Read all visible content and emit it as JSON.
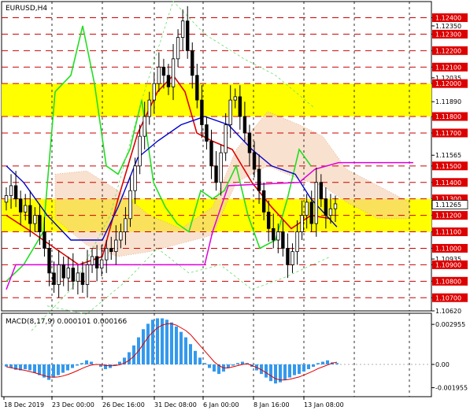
{
  "chart_data": {
    "type": "candlestick",
    "symbol_timeframe": "EURUSD,H4",
    "price_axis": {
      "range": [
        1.1062,
        1.1245
      ],
      "ticks": [
        "1.12400",
        "1.12350",
        "1.12300",
        "1.12200",
        "1.12100",
        "1.12035",
        "1.12000",
        "1.11890",
        "1.11800",
        "1.11700",
        "1.11565",
        "1.11500",
        "1.11400",
        "1.11300",
        "1.11265",
        "1.11200",
        "1.11100",
        "1.11000",
        "1.10935",
        "1.10900",
        "1.10800",
        "1.10700",
        "1.10620"
      ],
      "highlighted_levels": [
        "1.12400",
        "1.12300",
        "1.12200",
        "1.12100",
        "1.12000",
        "1.11800",
        "1.11700",
        "1.11500",
        "1.11400",
        "1.11300",
        "1.11200",
        "1.11100",
        "1.11000",
        "1.10900",
        "1.10800",
        "1.10700"
      ],
      "current_price": "1.11265"
    },
    "time_axis": [
      "18 Dec 2019",
      "23 Dec 00:00",
      "26 Dec 16:00",
      "31 Dec 08:00",
      "6 Jan 00:00",
      "8 Jan 16:00",
      "13 Jan 08:00"
    ],
    "resistance_support_zones": [
      {
        "from": 1.118,
        "to": 1.12
      },
      {
        "from": 1.111,
        "to": 1.113
      }
    ],
    "macd": {
      "label": "MACD(8,17,9) 0.000101 0.000166",
      "ticks": [
        "0.002955",
        "0.00",
        "-0.001955"
      ],
      "range": [
        -0.0023,
        0.0033
      ],
      "histogram": [
        -0.00018,
        -0.0003,
        -0.00045,
        -0.0005,
        -0.0004,
        -0.0005,
        -0.0007,
        -0.0009,
        -0.0011,
        -0.0013,
        -0.0011,
        -0.0009,
        -0.0007,
        -0.0005,
        -0.0003,
        -0.0001,
        0.0001,
        0.0003,
        0.0002,
        0.0,
        -0.0002,
        -0.0004,
        -0.0003,
        -0.0001,
        0.0002,
        0.0005,
        0.0009,
        0.0014,
        0.002,
        0.0026,
        0.003,
        0.0033,
        0.0034,
        0.0034,
        0.0033,
        0.0031,
        0.0028,
        0.0024,
        0.002,
        0.0015,
        0.001,
        0.0005,
        0.0001,
        -0.0003,
        -0.0006,
        -0.0008,
        -0.0006,
        -0.0003,
        -0.0001,
        0.0001,
        0.0002,
        0.0001,
        -0.0002,
        -0.0005,
        -0.0008,
        -0.0011,
        -0.0014,
        -0.0016,
        -0.0015,
        -0.0013,
        -0.0011,
        -0.0009,
        -0.0008,
        -0.0006,
        -0.0004,
        -0.0002,
        0.0001,
        0.0002,
        0.0003,
        0.00015,
        0.0001
      ],
      "signal": [
        -0.0002,
        -0.00028,
        -0.00036,
        -0.00043,
        -0.0005,
        -0.0006,
        -0.0007,
        -0.00082,
        -0.00094,
        -0.00105,
        -0.00108,
        -0.00105,
        -0.00097,
        -0.00085,
        -0.0007,
        -0.00053,
        -0.00035,
        -0.00018,
        -6e-05,
        0.0,
        -2e-05,
        -9e-05,
        -0.00012,
        -0.0001,
        -3e-05,
        0.0001,
        0.0003,
        0.0006,
        0.001,
        0.0015,
        0.002,
        0.0024,
        0.0027,
        0.0029,
        0.003,
        0.003,
        0.0029,
        0.0027,
        0.0025,
        0.0022,
        0.0018,
        0.0014,
        0.001,
        0.0006,
        0.0002,
        -0.0001,
        -0.0003,
        -0.0003,
        -0.0002,
        -0.0001,
        0.0,
        5e-05,
        -0.0001,
        -0.00025,
        -0.00045,
        -0.0007,
        -0.00095,
        -0.0012,
        -0.0013,
        -0.0013,
        -0.00125,
        -0.00115,
        -0.00105,
        -0.0009,
        -0.00072,
        -0.00055,
        -0.00035,
        -0.0002,
        -5e-05,
        0.0001,
        0.000166
      ]
    }
  }
}
